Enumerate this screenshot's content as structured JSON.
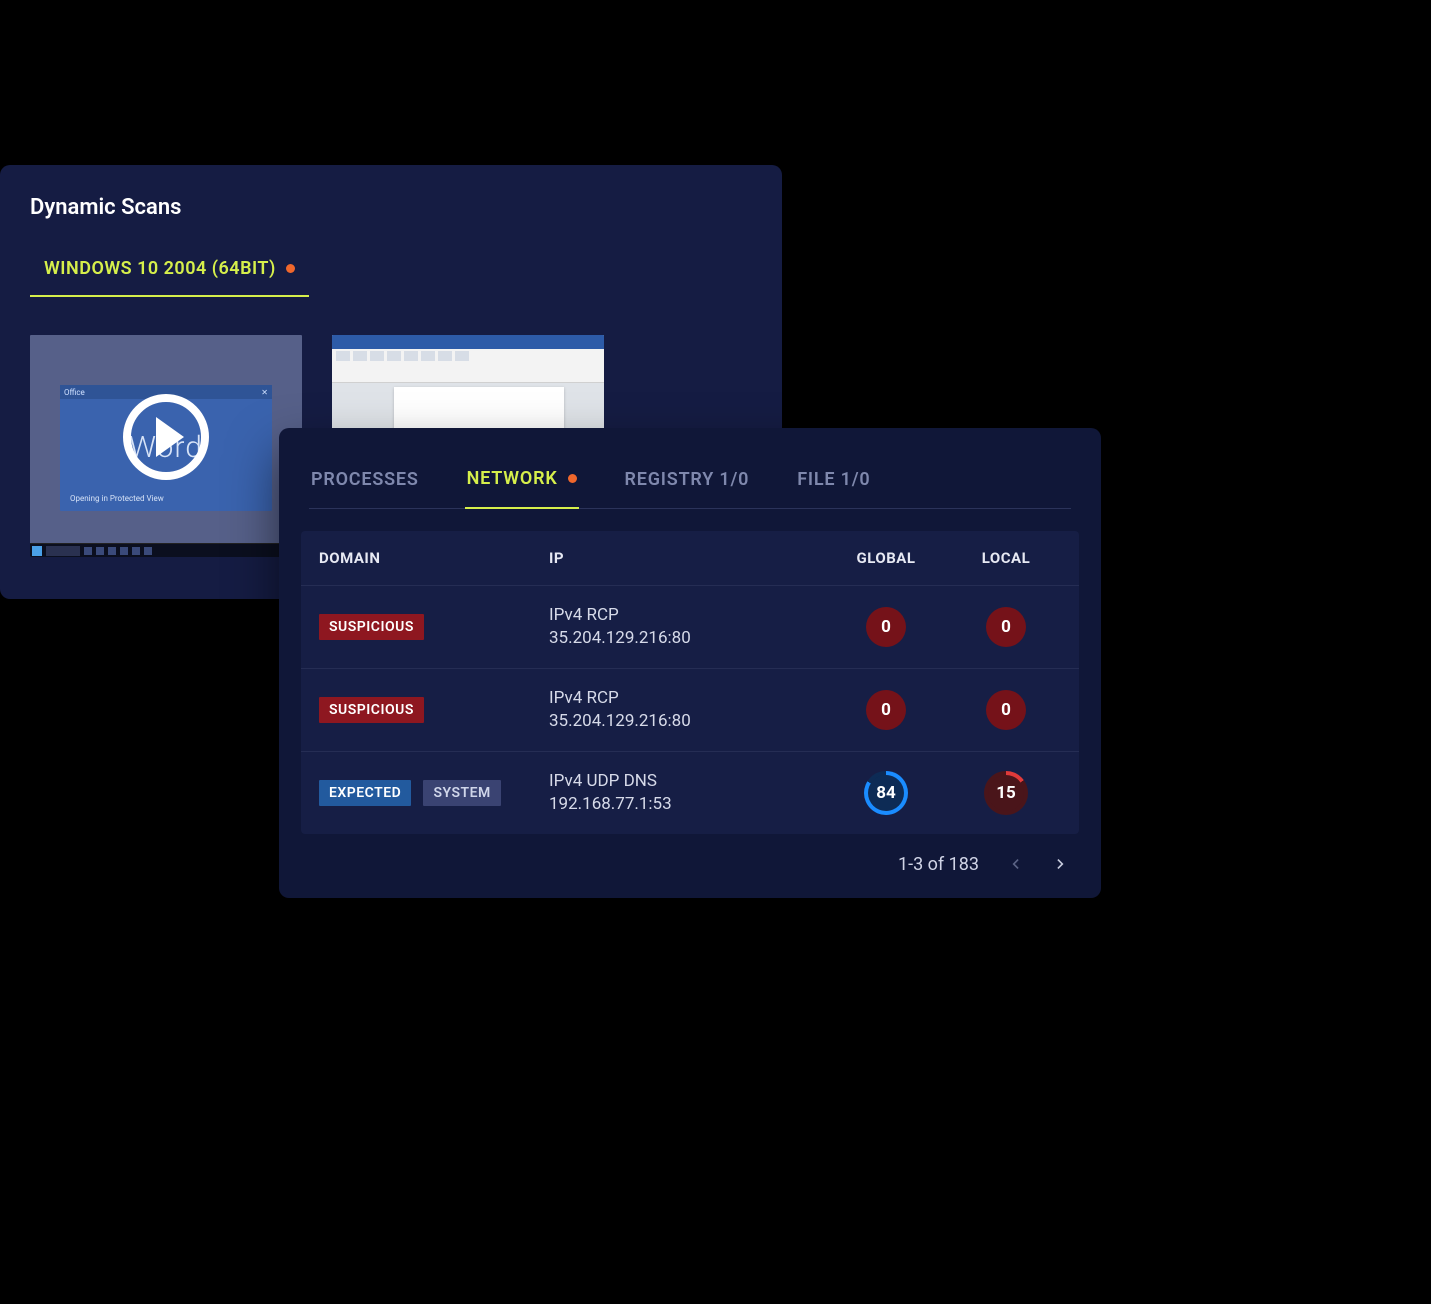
{
  "scans_panel": {
    "title": "Dynamic Scans",
    "os_tab": "WINDOWS 10 2004 (64BIT)",
    "thumb1": {
      "office_label": "Office",
      "word_label": "Word",
      "sub_label": "Opening in Protected View"
    }
  },
  "net_panel": {
    "tabs": [
      {
        "label": "PROCESSES",
        "active": false,
        "dot": false
      },
      {
        "label": "NETWORK",
        "active": true,
        "dot": true
      },
      {
        "label": "REGISTRY 1/0",
        "active": false,
        "dot": false
      },
      {
        "label": "FILE 1/0",
        "active": false,
        "dot": false
      }
    ],
    "headers": {
      "domain": "DOMAIN",
      "ip": "IP",
      "global": "GLOBAL",
      "local": "LOCAL"
    },
    "rows": [
      {
        "badges": [
          {
            "text": "SUSPICIOUS",
            "kind": "suspicious"
          }
        ],
        "proto": "IPv4 RCP",
        "addr": "35.204.129.216:80",
        "global": {
          "style": "pill",
          "value": "0"
        },
        "local": {
          "style": "pill",
          "value": "0"
        }
      },
      {
        "badges": [
          {
            "text": "SUSPICIOUS",
            "kind": "suspicious"
          }
        ],
        "proto": "IPv4 RCP",
        "addr": "35.204.129.216:80",
        "global": {
          "style": "pill",
          "value": "0"
        },
        "local": {
          "style": "pill",
          "value": "0"
        }
      },
      {
        "badges": [
          {
            "text": "EXPECTED",
            "kind": "expected"
          },
          {
            "text": "SYSTEM",
            "kind": "system"
          }
        ],
        "proto": "IPv4 UDP DNS",
        "addr": "192.168.77.1:53",
        "global": {
          "style": "ring-blue",
          "value": "84"
        },
        "local": {
          "style": "ring-red",
          "value": "15"
        }
      }
    ],
    "pagination": "1-3 of 183"
  }
}
